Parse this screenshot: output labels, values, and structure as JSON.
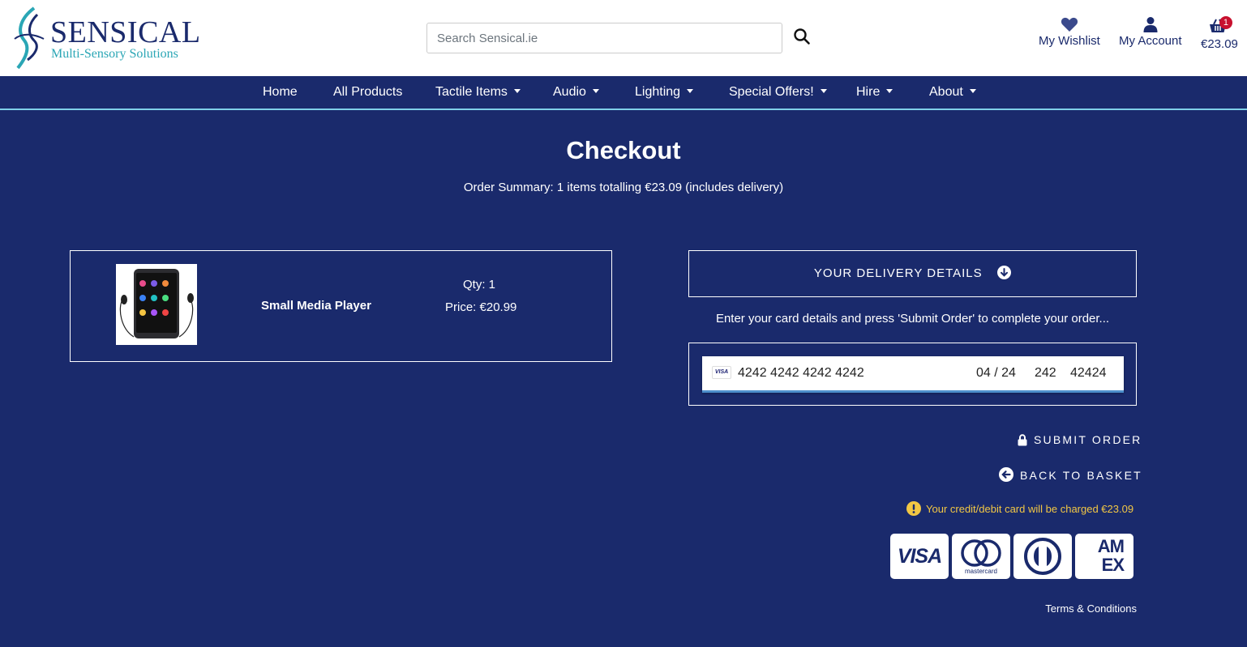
{
  "header": {
    "logo": {
      "name": "SENSICAL",
      "tagline": "Multi-Sensory Solutions"
    },
    "search": {
      "placeholder": "Search Sensical.ie",
      "value": ""
    },
    "wishlist_label": "My Wishlist",
    "account_label": "My Account",
    "basket": {
      "total": "€23.09",
      "count": "1"
    }
  },
  "nav": {
    "items": [
      {
        "label": "Home"
      },
      {
        "label": "All Products"
      },
      {
        "label": "Tactile Items"
      },
      {
        "label": "Audio"
      },
      {
        "label": "Lighting"
      },
      {
        "label": "Special Offers!"
      },
      {
        "label": "Hire"
      },
      {
        "label": "About"
      }
    ]
  },
  "checkout": {
    "title": "Checkout",
    "summary": "Order Summary: 1 items totalling €23.09 (includes delivery)",
    "item": {
      "name": "Small Media Player",
      "qty": "Qty: 1",
      "price": "Price: €20.99"
    },
    "delivery_label": "YOUR DELIVERY DETAILS",
    "instruction": "Enter your card details and press 'Submit Order' to complete your order...",
    "card": {
      "brand": "VISA",
      "number": "4242 4242 4242 4242",
      "expiry": "04 / 24",
      "cvc": "242",
      "postcode": "42424"
    },
    "submit_label": "SUBMIT ORDER",
    "back_label": "BACK TO BASKET",
    "charge_note": "Your credit/debit card will be charged €23.09",
    "accepted_cards": {
      "visa": "VISA",
      "mastercard": "mastercard",
      "amex": "AM EX"
    },
    "terms_label": "Terms & Conditions"
  },
  "colors": {
    "brand_navy": "#1a2a6c",
    "accent_teal": "#2aa6b5",
    "warning_yellow": "#f2c744",
    "badge_red": "#c8102e"
  }
}
